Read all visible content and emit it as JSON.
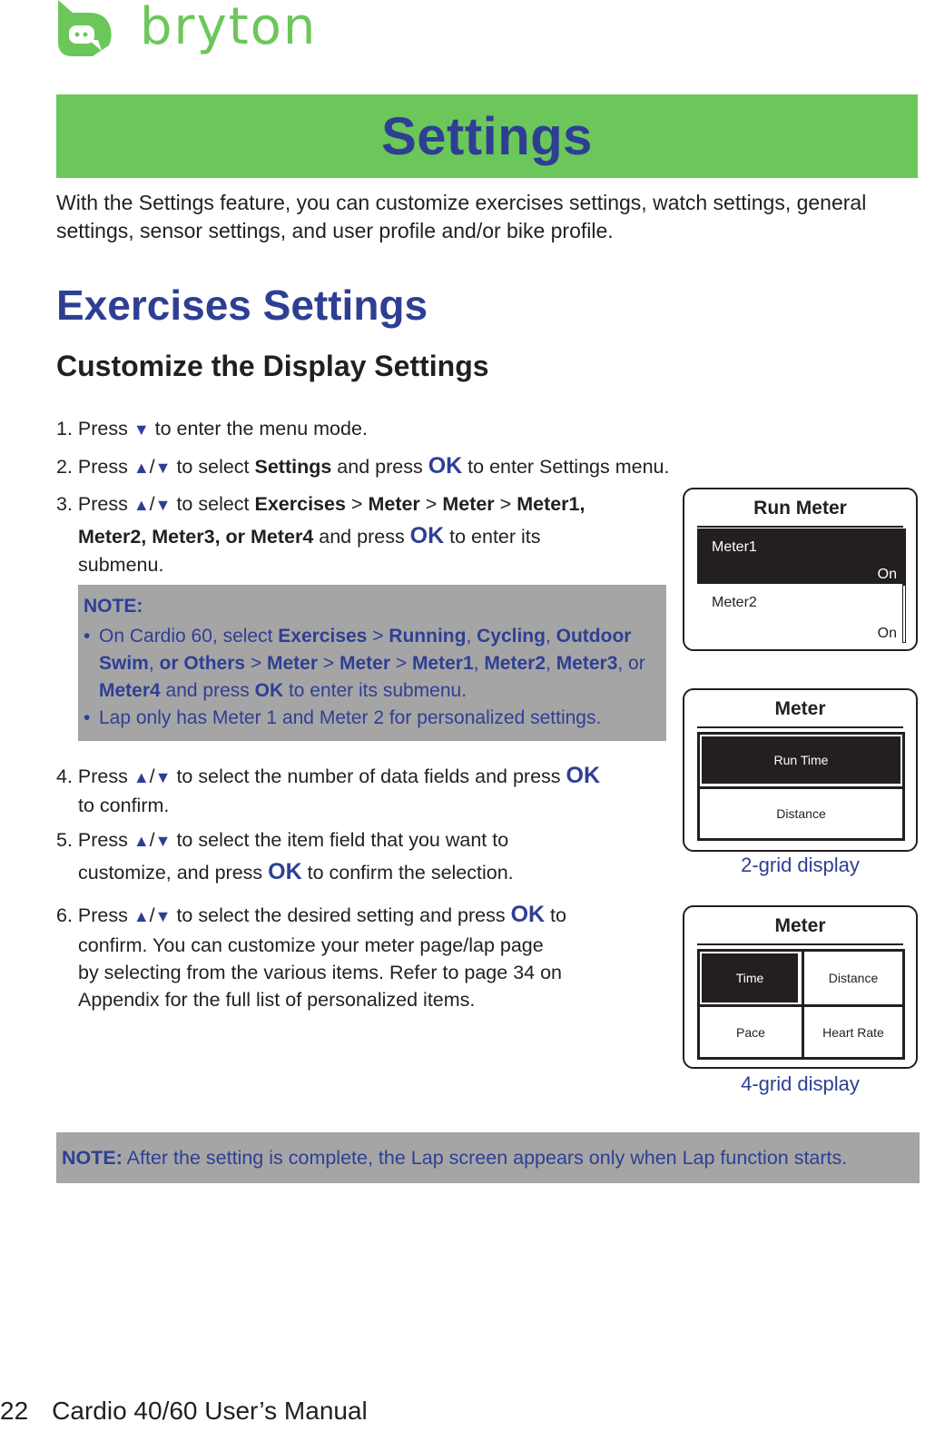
{
  "header": {
    "brand": "bryton",
    "brand_color": "#6cc75a"
  },
  "banner": {
    "title": "Settings",
    "bg_color": "#6cc75a",
    "text_color": "#2e3f93"
  },
  "intro": "With the Settings feature, you can customize exercises settings, watch settings, general settings, sensor settings, and user profile and/or bike profile.",
  "section_title": "Exercises Settings",
  "subsection_title": "Customize the Display Settings",
  "symbols": {
    "up": "▲",
    "down": "▼",
    "slash": "/",
    "ok": "OK",
    "gt": " > ",
    "comma": ", "
  },
  "steps": {
    "s1": {
      "num": "1. Press ",
      "rest": " to enter the menu mode."
    },
    "s2": {
      "num": "2. Press ",
      "a": " to select ",
      "b": "Settings",
      "c": " and press ",
      "d": " to enter Settings menu."
    },
    "s3": {
      "num": "3. Press ",
      "a": " to select ",
      "p1": "Exercises",
      "p2": "Meter",
      "p3": "Meter",
      "p4": "Meter1,",
      "line2_bold": "Meter2, Meter3, or Meter4",
      "c": " and press ",
      "d": " to enter its",
      "line3": "submenu."
    },
    "s4": {
      "num": "4. Press ",
      "a": " to select the number of data fields and press ",
      "line2": "to confirm."
    },
    "s5": {
      "num": "5. Press ",
      "a": " to select the item field that you want to",
      "line2a": "customize, and press ",
      "line2b": " to confirm the selection."
    },
    "s6": {
      "num": "6. Press ",
      "a": " to select the desired setting and press ",
      "b": " to",
      "line2": "confirm. You can customize your meter page/lap page",
      "line3": "by selecting from the various items. Refer to page 34 on",
      "line4": "Appendix for the full list of personalized items."
    }
  },
  "note1": {
    "title": "NOTE:",
    "bullet": "•",
    "b1": {
      "t1": "On Cardio 60, select ",
      "e1": "Exercises",
      "e2": "Running",
      "e3": "Cycling",
      "e4": "Outdoor Swim",
      "e5": "or Others",
      "e6": "Meter",
      "e7": "Meter",
      "e8": "Meter1",
      "e9": "Meter2",
      "e10": "Meter3",
      "or": ", or ",
      "e11": "Meter4",
      "t2": " and press ",
      "ok": "OK",
      "t3": " to enter its submenu."
    },
    "b2": "Lap only has Meter 1 and Meter 2 for personalized settings."
  },
  "devices": {
    "run_meter": {
      "title": "Run Meter",
      "items": [
        {
          "label": "Meter1",
          "value": "On",
          "selected": true
        },
        {
          "label": "Meter2",
          "value": "On",
          "selected": false
        }
      ]
    },
    "grid2": {
      "title": "Meter",
      "cells": [
        "Run Time",
        "Distance"
      ],
      "caption": "2-grid display"
    },
    "grid4": {
      "title": "Meter",
      "cells": [
        "Time",
        "Distance",
        "Pace",
        "Heart Rate"
      ],
      "caption": "4-grid display"
    }
  },
  "note2": {
    "label": "NOTE:",
    "text": " After the setting is complete, the Lap screen appears only when Lap function starts."
  },
  "footer": {
    "page_number": "22",
    "manual_title": "Cardio 40/60 User’s Manual"
  }
}
